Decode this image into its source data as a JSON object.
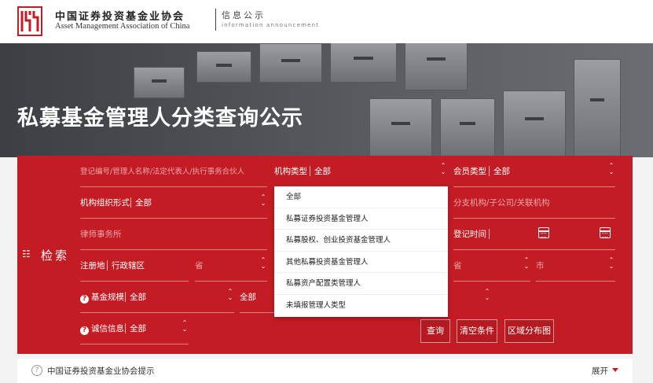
{
  "header": {
    "org_name_cn": "中国证券投资基金业协会",
    "org_name_en": "Asset Management Association of China",
    "section_cn": "信息公示",
    "section_en": "information announcement"
  },
  "banner": {
    "title": "私募基金管理人分类查询公示"
  },
  "search": {
    "label": "检索",
    "keyword_placeholder": "登记编号/管理人名称/法定代表人/执行事务合伙人",
    "org_type_label": "机构类型",
    "org_type_value": "全部",
    "member_type_label": "会员类型",
    "member_type_value": "全部",
    "org_form_label": "机构组织形式",
    "org_form_value": "全部",
    "branch_placeholder": "分支机构/子公司/关联机构",
    "law_firm_placeholder": "律师事务所",
    "reg_time_label": "登记时间",
    "reg_place_label": "注册地",
    "district_label": "行政辖区",
    "province_placeholder": "省",
    "province2_placeholder": "省",
    "city_placeholder": "市",
    "fund_scale_label": "基金规模",
    "fund_scale_value": "全部",
    "fund_scale_value2": "全部",
    "integrity_label": "诚信信息",
    "integrity_value": "全部",
    "buttons": {
      "query": "查询",
      "clear": "清空条件",
      "region_map": "区域分布图"
    }
  },
  "dropdown": {
    "options": [
      "全部",
      "私募证券投资基金管理人",
      "私募股权、创业投资基金管理人",
      "其他私募投资基金管理人",
      "私募资产配置类管理人",
      "未填报管理人类型"
    ]
  },
  "tips": {
    "text": "中国证券投资基金业协会提示",
    "expand": "展开"
  }
}
